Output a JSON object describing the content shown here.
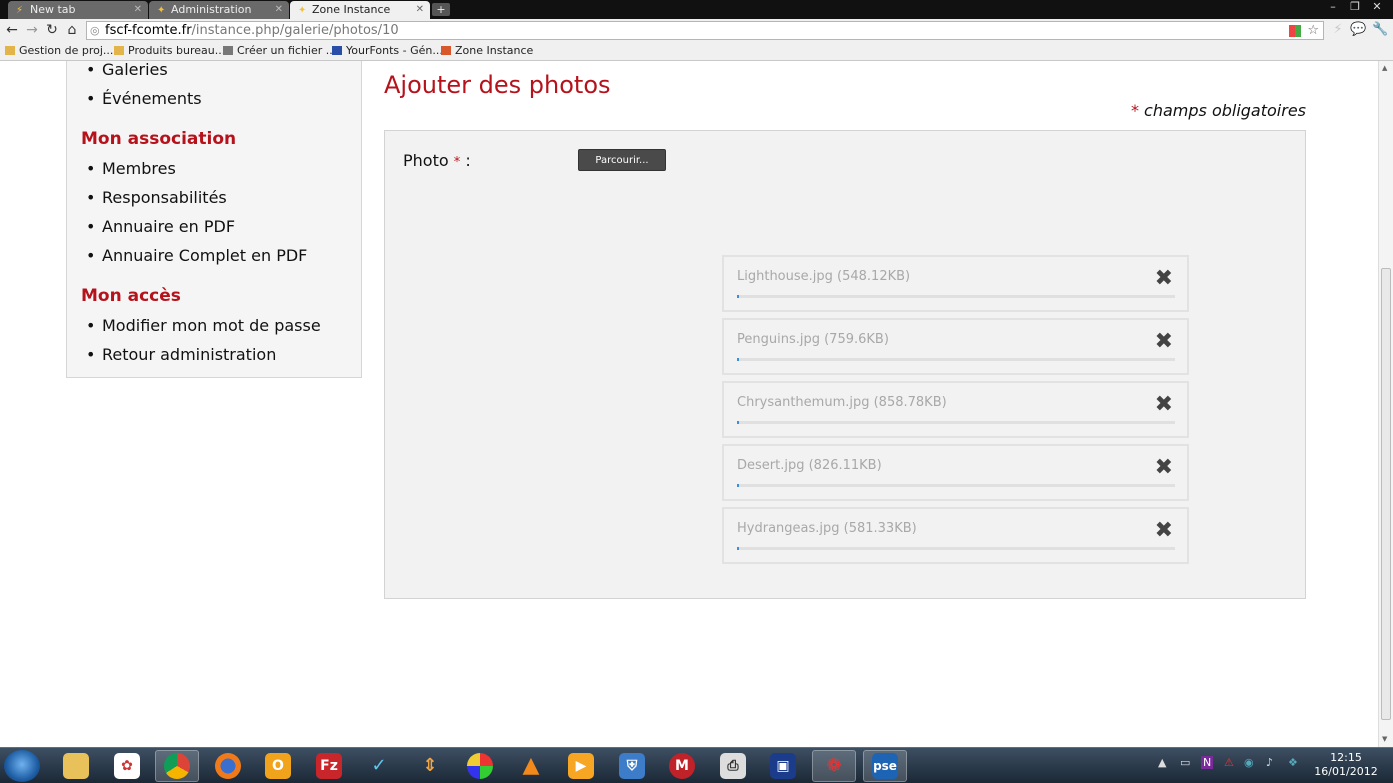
{
  "browser": {
    "tabs": [
      {
        "title": "New tab"
      },
      {
        "title": "Administration"
      },
      {
        "title": "Zone Instance"
      }
    ],
    "url_host": "fscf-fcomte.fr",
    "url_path": "/instance.php/galerie/photos/10",
    "bookmarks": [
      {
        "label": "Gestion de proj..."
      },
      {
        "label": "Produits bureau..."
      },
      {
        "label": "Créer un fichier ..."
      },
      {
        "label": "YourFonts - Gén..."
      },
      {
        "label": "Zone Instance"
      }
    ]
  },
  "sidebar": {
    "top_items": [
      "Galeries",
      "Événements"
    ],
    "sections": [
      {
        "heading": "Mon association",
        "items": [
          "Membres",
          "Responsabilités",
          "Annuaire en PDF",
          "Annuaire Complet en PDF"
        ]
      },
      {
        "heading": "Mon accès",
        "items": [
          "Modifier mon mot de passe",
          "Retour administration"
        ]
      }
    ]
  },
  "main": {
    "title": "Ajouter des photos",
    "required_asterisk": "*",
    "required_note": "champs obligatoires",
    "photo_label": "Photo",
    "photo_colon": ":",
    "browse_label": "Parcourir...",
    "files": [
      {
        "name": "Lighthouse.jpg (548.12KB)",
        "progress": 0.005
      },
      {
        "name": "Penguins.jpg (759.6KB)",
        "progress": 0.005
      },
      {
        "name": "Chrysanthemum.jpg (858.78KB)",
        "progress": 0.005
      },
      {
        "name": "Desert.jpg (826.11KB)",
        "progress": 0.005
      },
      {
        "name": "Hydrangeas.jpg (581.33KB)",
        "progress": 0.005
      }
    ],
    "remove_glyph": "✖"
  },
  "taskbar": {
    "time": "12:15",
    "date": "16/01/2012"
  },
  "colors": {
    "accent": "#b5121b",
    "progress": "#3f8fd6"
  }
}
